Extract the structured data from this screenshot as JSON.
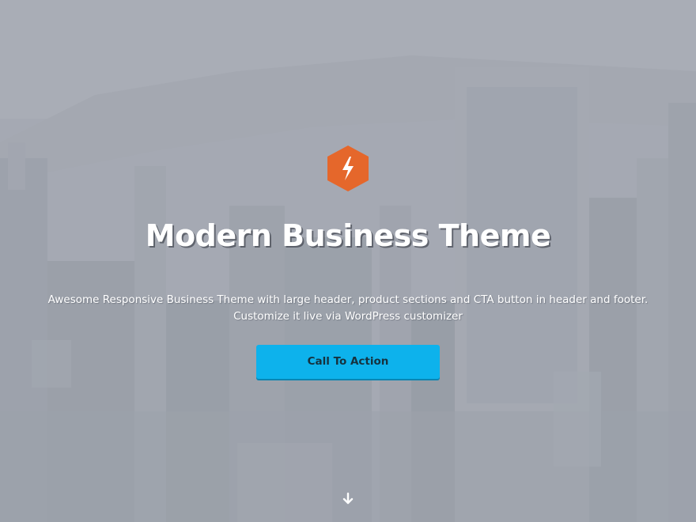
{
  "hero": {
    "title": "Modern Business Theme",
    "subtitle_line1": "Awesome Responsive Business Theme with large header, product sections and CTA button in header and footer.",
    "subtitle_line2": "Customize it live via WordPress customizer",
    "cta_label": "Call To Action",
    "logo_icon": "lightning-bolt-icon",
    "scroll_icon": "arrow-down-icon",
    "background_image": "city-skyline-aerial-photo"
  },
  "colors": {
    "accent_cta": "#0db2ec",
    "logo_orange": "#e5672b",
    "overlay": "#a3a8b1",
    "text": "#ffffff"
  }
}
